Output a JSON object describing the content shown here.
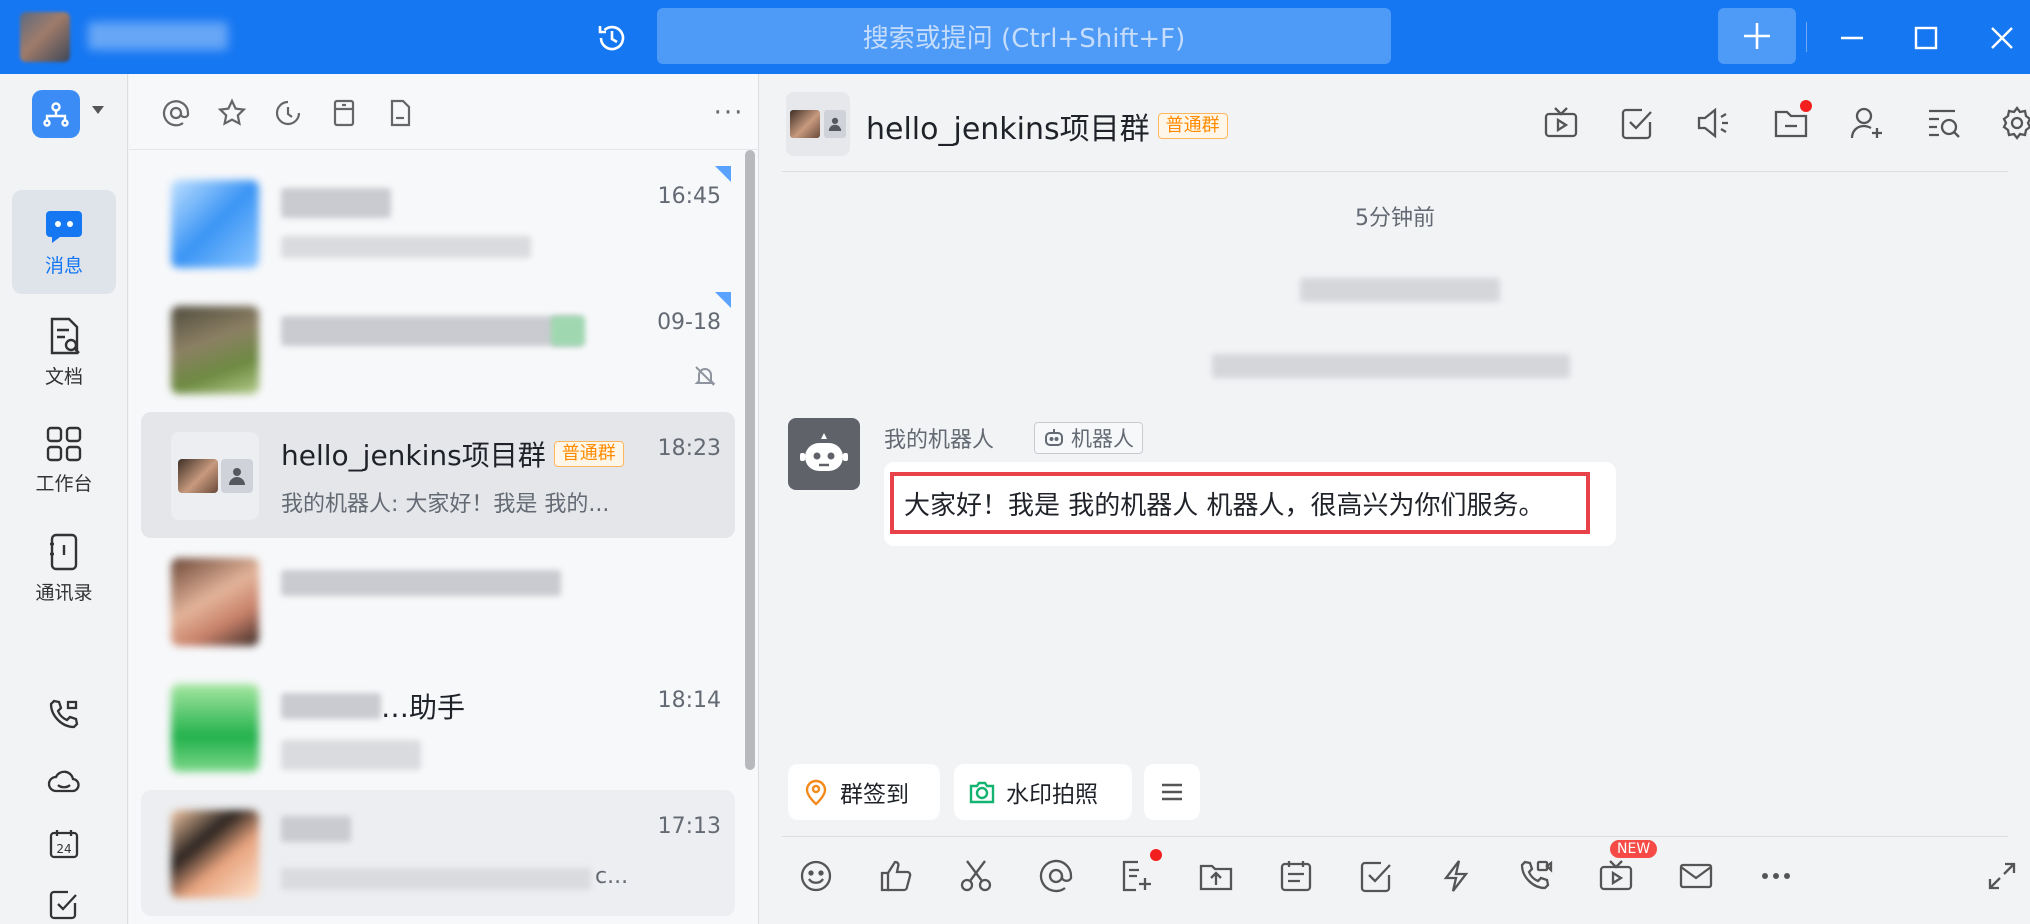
{
  "titlebar": {
    "search_placeholder": "搜索或提问 (Ctrl+Shift+F)"
  },
  "nav": {
    "items": [
      {
        "label": "消息",
        "icon": "message-icon",
        "active": true
      },
      {
        "label": "文档",
        "icon": "doc-icon",
        "active": false
      },
      {
        "label": "工作台",
        "icon": "workbench-icon",
        "active": false
      },
      {
        "label": "通讯录",
        "icon": "contacts-icon",
        "active": false
      }
    ],
    "small_icons": [
      "phone-icon",
      "cloud-icon",
      "calendar-icon",
      "todo-icon"
    ],
    "calendar_day": "24"
  },
  "chat_list": {
    "conversations": [
      {
        "time": "16:45",
        "title": "",
        "preview": "",
        "blurred": true
      },
      {
        "time": "09-18",
        "title": "",
        "preview": "",
        "blurred": true,
        "muted": true
      },
      {
        "time": "18:23",
        "title": "hello_jenkins项目群",
        "tag": "普通群",
        "preview": "我的机器人: 大家好！我是 我的...",
        "selected": true
      },
      {
        "time": "",
        "title": "",
        "preview": "",
        "blurred": true
      },
      {
        "time": "18:14",
        "title": "…助手",
        "preview": "",
        "blurred": true
      },
      {
        "time": "17:13",
        "title": "",
        "preview": "c...",
        "blurred": true
      }
    ]
  },
  "chat": {
    "title": "hello_jenkins项目群",
    "tag": "普通群",
    "timestamp": "5分钟前",
    "message": {
      "sender": "我的机器人",
      "sender_tag": "机器人",
      "text": "大家好！我是 我的机器人 机器人，很高兴为你们服务。"
    },
    "quick_actions": [
      {
        "label": "群签到",
        "icon": "checkin-icon",
        "color": "#f28a1c"
      },
      {
        "label": "水印拍照",
        "icon": "camera-icon",
        "color": "#15b371"
      }
    ],
    "new_badge": "NEW"
  },
  "colors": {
    "brand": "#1677f2",
    "highlight_border": "#e8414a",
    "tag_orange": "#ff8c00"
  }
}
